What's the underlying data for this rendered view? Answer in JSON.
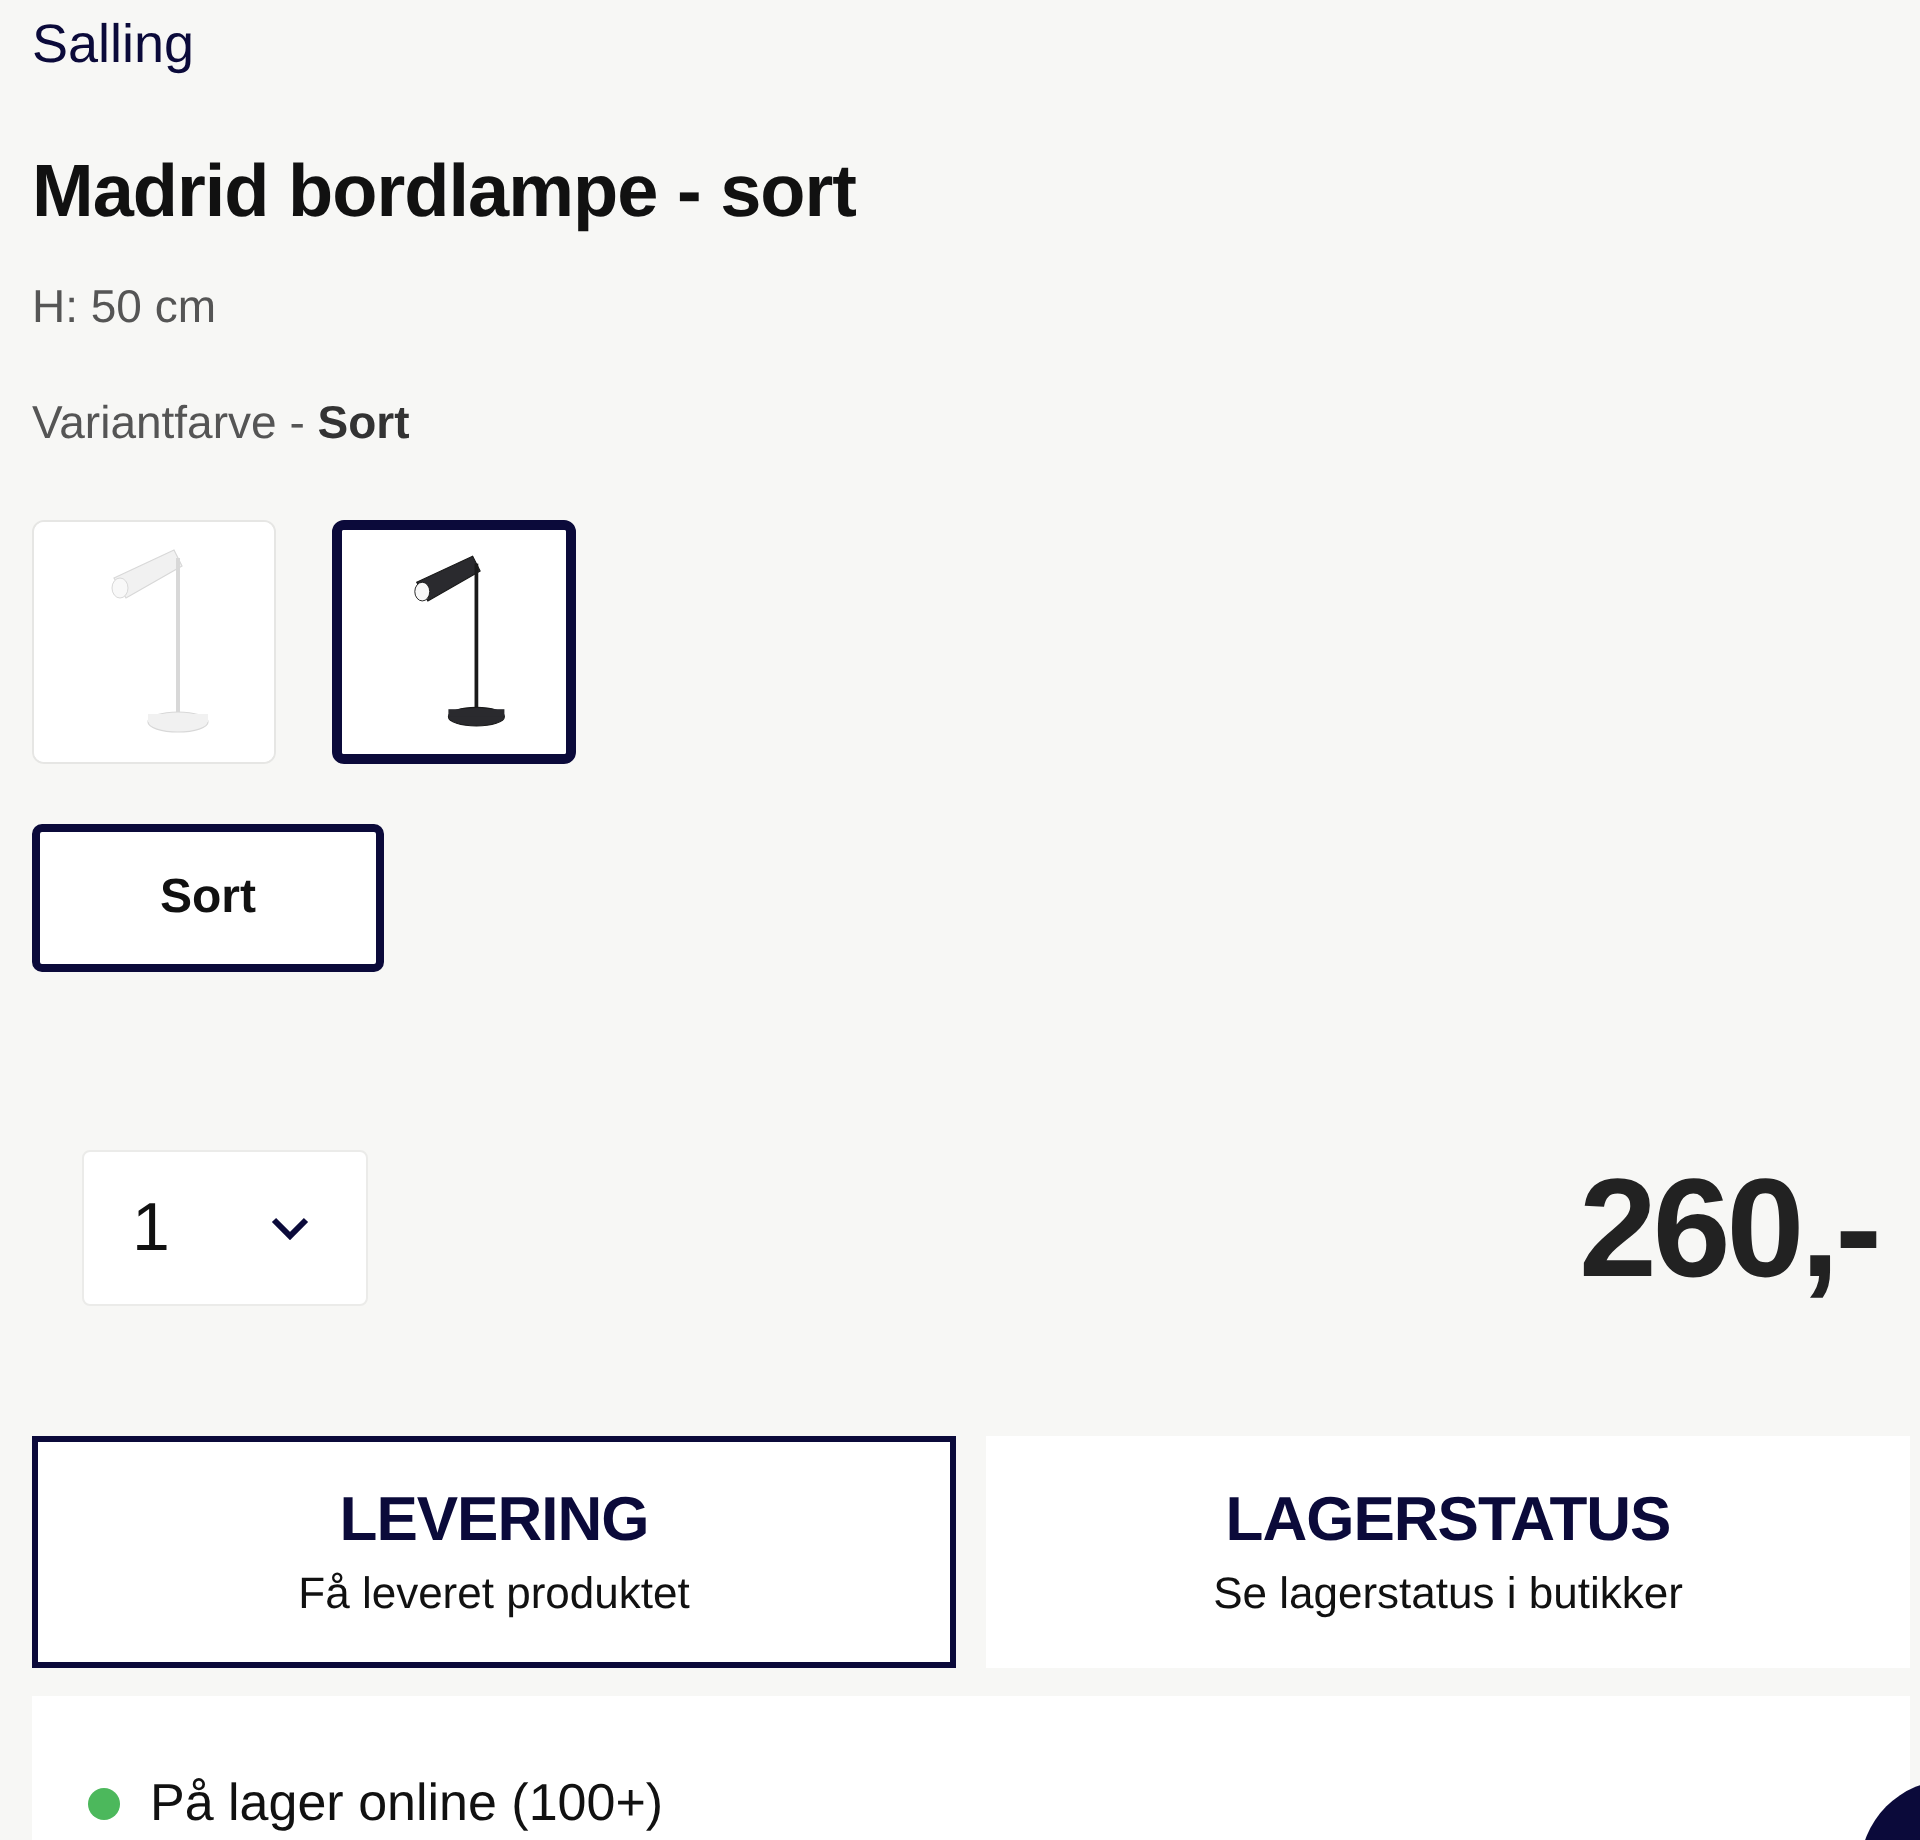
{
  "brand": "Salling",
  "title": "Madrid bordlampe - sort",
  "height": "H: 50 cm",
  "variant": {
    "label": "Variantfarve - ",
    "value": "Sort"
  },
  "thumbnails": [
    {
      "kind": "picture",
      "selected": false
    },
    {
      "kind": "picture",
      "selected": true
    }
  ],
  "color_options": [
    {
      "label": "Sort",
      "selected": true
    }
  ],
  "quantity": {
    "value": "1"
  },
  "price": "260,-",
  "tabs": [
    {
      "title": "LEVERING",
      "subtitle": "Få leveret produktet",
      "selected": true
    },
    {
      "title": "LAGERSTATUS",
      "subtitle": "Se lagerstatus i butikker",
      "selected": false
    }
  ],
  "stock": [
    {
      "text": "På lager online (100+)",
      "color": "#4cb85c"
    }
  ]
}
